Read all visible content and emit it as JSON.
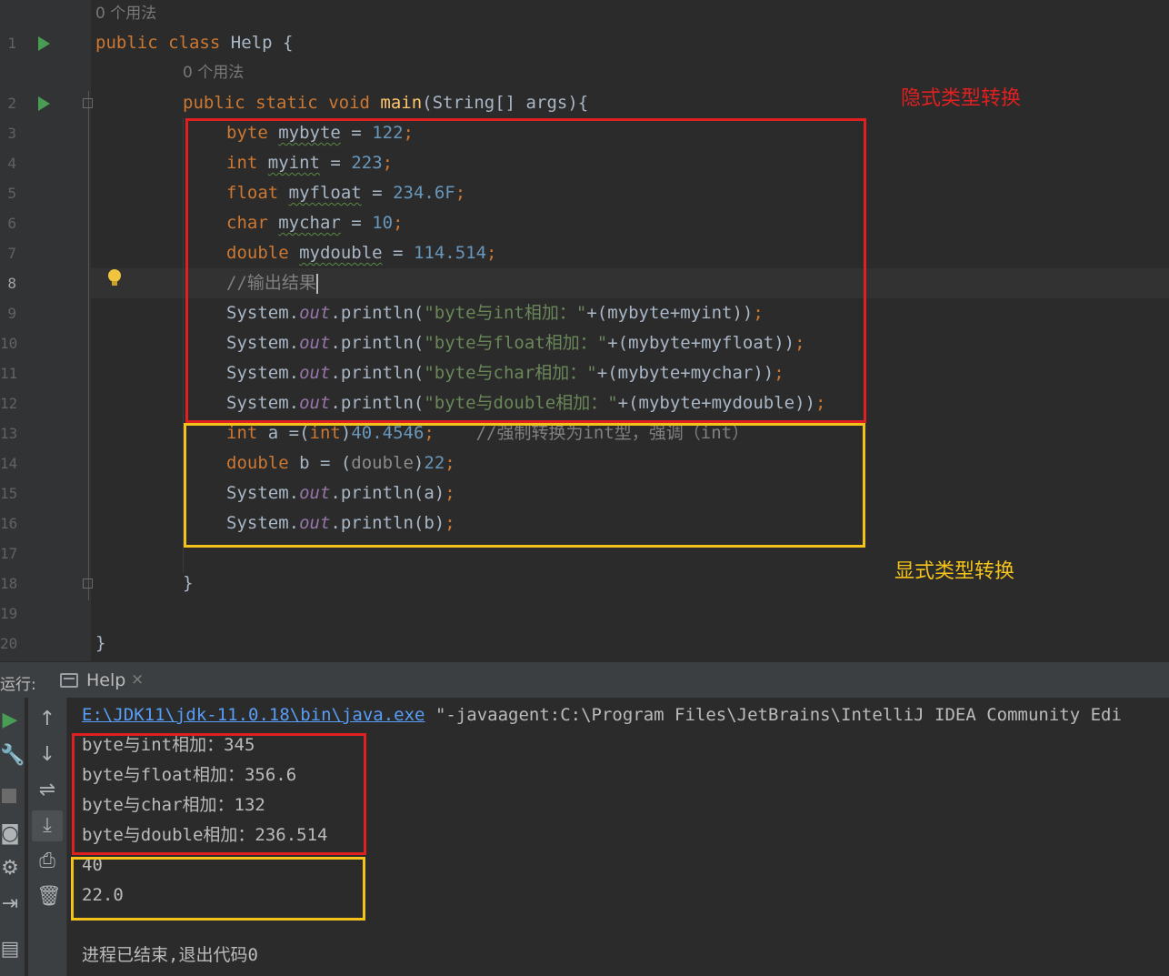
{
  "editor": {
    "usage_hint_class": "0 个用法",
    "usage_hint_main": "0 个用法",
    "line_numbers": [
      "1",
      "2",
      "3",
      "4",
      "5",
      "6",
      "7",
      "8",
      "9",
      "10",
      "11",
      "12",
      "13",
      "14",
      "15",
      "16",
      "17",
      "18",
      "19",
      "20"
    ],
    "current_line": "8",
    "code": {
      "l1_kw1": "public",
      "l1_kw2": "class",
      "l1_name": "Help",
      "l1_brace": " {",
      "l2_kw1": "public",
      "l2_kw2": "static",
      "l2_kw3": "void",
      "l2_fn": "main",
      "l2_params": "(String[] args){",
      "l3_type": "byte",
      "l3_var": "mybyte",
      "l3_eq": " = ",
      "l3_val": "122",
      "l3_semi": ";",
      "l4_type": "int",
      "l4_var": "myint",
      "l4_eq": " = ",
      "l4_val": "223",
      "l4_semi": ";",
      "l5_type": "float",
      "l5_var": "myfloat",
      "l5_eq": " = ",
      "l5_val": "234.6F",
      "l5_semi": ";",
      "l6_type": "char",
      "l6_var": "mychar",
      "l6_eq": " = ",
      "l6_val": "10",
      "l6_semi": ";",
      "l7_type": "double",
      "l7_var": "mydouble",
      "l7_eq": " = ",
      "l7_val": "114.514",
      "l7_semi": ";",
      "l8_comment": "//输出结果",
      "sys": "System.",
      "out": "out",
      "println": ".println(",
      "l9_str": "\"byte与int相加：\"",
      "l9_rest": "+(mybyte+myint))",
      "l9_semi": ";",
      "l10_str": "\"byte与float相加：\"",
      "l10_rest": "+(mybyte+myfloat))",
      "l10_semi": ";",
      "l11_str": "\"byte与char相加：\"",
      "l11_rest": "+(mybyte+mychar))",
      "l11_semi": ";",
      "l12_str": "\"byte与double相加：\"",
      "l12_rest": "+(mybyte+mydouble))",
      "l12_semi": ";",
      "l13_type": "int",
      "l13_mid": " a =(",
      "l13_cast": "int",
      "l13_close": ")",
      "l13_val": "40.4546",
      "l13_semi": ";",
      "l13_comment": "//强制转换为int型，强调（int）",
      "l14_type": "double",
      "l14_mid": " b = (",
      "l14_cast": "double",
      "l14_close": ")",
      "l14_val": "22",
      "l14_semi": ";",
      "l15_rest": "a)",
      "l15_semi": ";",
      "l16_rest": "b)",
      "l16_semi": ";",
      "l18_brace": "}",
      "l20_brace": "}"
    }
  },
  "annotations": {
    "implicit": "隐式类型转换",
    "explicit": "显式类型转换",
    "implicit_color": "#e02020",
    "explicit_color": "#f3c21b"
  },
  "run_panel": {
    "label": "运行:",
    "tab_name": "Help",
    "tab_close": "×",
    "command_path": "E:\\JDK11\\jdk-11.0.18\\bin\\java.exe",
    "command_args": " \"-javaagent:C:\\Program Files\\JetBrains\\IntelliJ IDEA Community Edi",
    "output": [
      "byte与int相加：345",
      "byte与float相加：356.6",
      "byte与char相加：132",
      "byte与double相加：236.514",
      "40",
      "22.0"
    ],
    "exit_message": "进程已结束,退出代码0"
  },
  "icons": {
    "rerun": "play-icon",
    "wrench": "wrench-icon",
    "stop": "stop-icon",
    "camera": "camera-icon",
    "settings": "gear-icon",
    "exit": "exit-icon",
    "layout": "layout-icon",
    "up": "arrow-up-icon",
    "down": "arrow-down-icon",
    "wrap": "soft-wrap-icon",
    "scroll": "scroll-to-end-icon",
    "print": "print-icon",
    "trash": "trash-icon"
  },
  "colors": {
    "keyword": "#cc7832",
    "number": "#6897bb",
    "string": "#6a8759",
    "method": "#ffc66d",
    "static_field": "#9876aa",
    "comment": "#808080"
  }
}
